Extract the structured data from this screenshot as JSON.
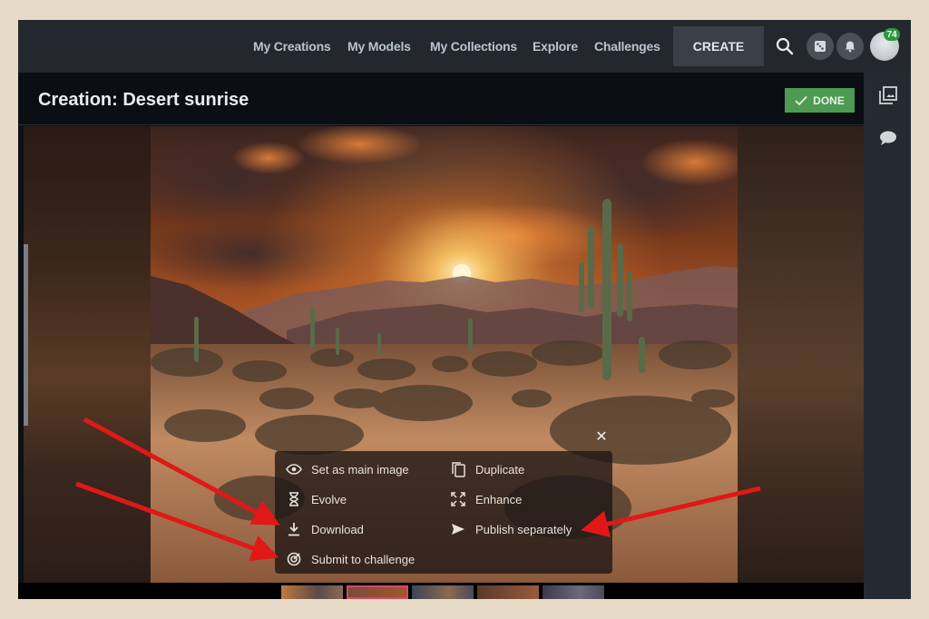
{
  "nav": {
    "links": [
      "My Creations",
      "My Models",
      "My Collections",
      "Explore",
      "Challenges"
    ],
    "create_label": "CREATE",
    "notification_count": "74"
  },
  "header": {
    "title": "Creation: Desert sunrise",
    "done_label": "DONE"
  },
  "image": {
    "subject": "Desert sunrise with saguaro cacti"
  },
  "popup": {
    "items": [
      {
        "label": "Set as main image",
        "icon": "eye-icon"
      },
      {
        "label": "Duplicate",
        "icon": "duplicate-icon"
      },
      {
        "label": "Evolve",
        "icon": "hourglass-icon"
      },
      {
        "label": "Enhance",
        "icon": "enhance-icon"
      },
      {
        "label": "Download",
        "icon": "download-icon"
      },
      {
        "label": "Publish separately",
        "icon": "send-icon"
      },
      {
        "label": "Submit to challenge",
        "icon": "target-icon"
      }
    ],
    "close_icon": "close-icon"
  },
  "thumbnails": {
    "count": 5,
    "selected_index": 1
  },
  "colors": {
    "done_green": "#4e9a52",
    "badge_green": "#2b9a3a",
    "selected_thumb": "#d4486a",
    "annotation_arrow": "#e01818"
  }
}
